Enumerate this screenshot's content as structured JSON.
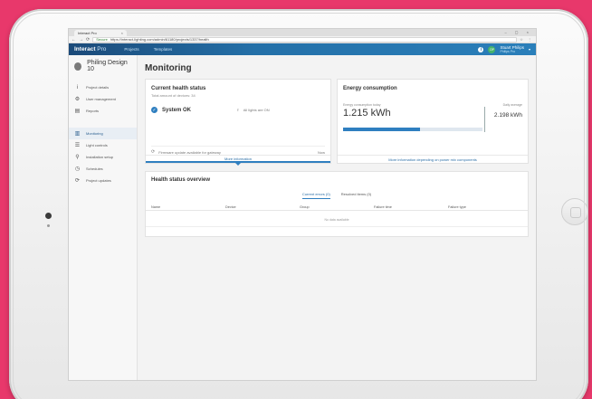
{
  "browser": {
    "tab_title": "Interact Pro",
    "tab_close": "×",
    "window_controls": "–  ▢  ×",
    "url_prefix": "Secure",
    "url": "https://interact-lighting.com/admin/61180/projects/1337/health",
    "tools": "☆  ⋮"
  },
  "appbar": {
    "brand": "Interact",
    "brand_suffix": "Pro",
    "nav_projects": "Projects",
    "nav_templates": "Templates",
    "info": "i",
    "user_initials": "OP",
    "user_name": "Stuart Philips",
    "user_role": "Philips Pro",
    "caret": "▾"
  },
  "sidebar": {
    "project_name": "Philing Design 10",
    "items": [
      {
        "label": "Project details",
        "icon": "i"
      },
      {
        "label": "User management",
        "icon": "⚙"
      },
      {
        "label": "Reports",
        "icon": "▤"
      },
      {
        "label": "Monitoring",
        "icon": "▥"
      },
      {
        "label": "Light controls",
        "icon": "☰"
      },
      {
        "label": "Installation setup",
        "icon": "⚲"
      },
      {
        "label": "Schedules",
        "icon": "◷"
      },
      {
        "label": "Project updates",
        "icon": "⟳"
      }
    ]
  },
  "main": {
    "page_title": "Monitoring",
    "health": {
      "title": "Current health status",
      "subtitle": "Total amount of devices: 34",
      "check": "✓",
      "status": "System OK",
      "bulb": "♀",
      "lights": "All lights are ON",
      "fw_icon": "⟳",
      "firmware_text": "Firmware update available for gateway",
      "firmware_time": "Now",
      "link": "More information"
    },
    "energy": {
      "title": "Energy consumption",
      "label_current": "Energy consumption today",
      "label_avg": "Daily average",
      "value_current": "1.215 kWh",
      "value_avg": "2.198 kWh",
      "fill_percent": 55,
      "link": "More information depending on power mix components"
    },
    "overview": {
      "title": "Health status overview",
      "tab_active": "Current errors (0)",
      "tab_other": "Resolved items (0)",
      "columns": [
        "Name",
        "Device",
        "Group",
        "Failure time",
        "Failure type"
      ],
      "empty": "No data available"
    }
  },
  "colors": {
    "background": "#e8386b",
    "appbar": "#2470a8",
    "accent": "#2f7fc0"
  }
}
